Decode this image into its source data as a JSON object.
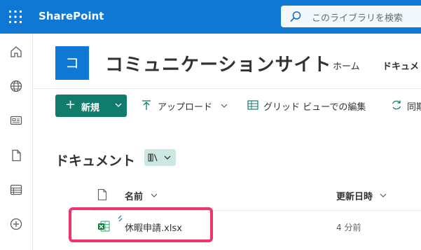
{
  "suite": {
    "brand": "SharePoint",
    "search_placeholder": "このライブラリを検索"
  },
  "rail": {
    "icons": [
      "home-icon",
      "globe-icon",
      "news-icon",
      "document-icon",
      "lists-icon",
      "add-circle-icon"
    ]
  },
  "site": {
    "logo_letter": "コ",
    "title": "コミュニケーションサイト",
    "nav": {
      "home": "ホーム",
      "documents": "ドキュメ"
    }
  },
  "commandbar": {
    "new_label": "新規",
    "upload_label": "アップロード",
    "grid_edit_label": "グリッド ビューでの編集",
    "sync_label": "同期"
  },
  "library": {
    "title": "ドキュメント",
    "columns": {
      "name": "名前",
      "modified": "更新日時"
    },
    "files": [
      {
        "name": "休暇申請.xlsx",
        "modified": "4 分前",
        "type": "excel"
      }
    ]
  },
  "colors": {
    "suite_bar": "#0f78d4",
    "new_button": "#107c6b",
    "highlight": "#f0346c"
  }
}
